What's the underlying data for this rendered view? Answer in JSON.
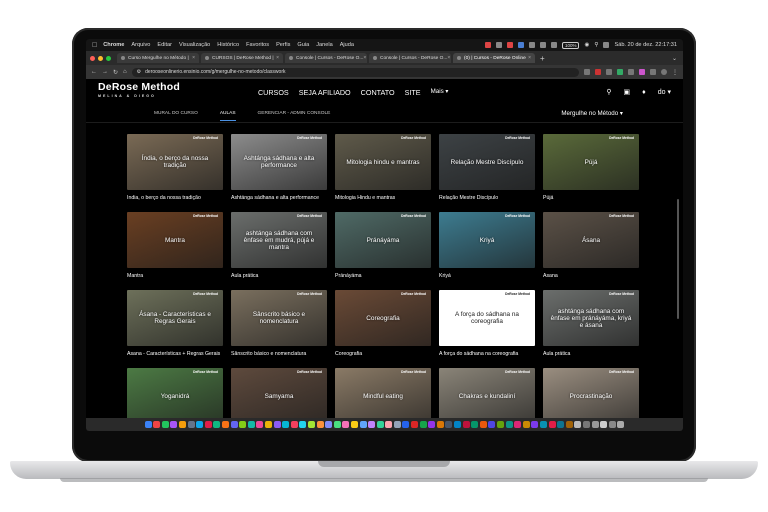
{
  "menubar": {
    "items": [
      "Chrome",
      "Arquivo",
      "Editar",
      "Visualização",
      "Histórico",
      "Favoritos",
      "Perfis",
      "Guia",
      "Janela",
      "Ajuda"
    ],
    "battery": "100%",
    "datetime": "Sáb. 20 de dez.  22:17:31"
  },
  "tabs": [
    {
      "label": "Curso Mergulhe no Método |"
    },
    {
      "label": "CURSOS | DeRose Method |"
    },
    {
      "label": "Console | Cursos - DeRose O..."
    },
    {
      "label": "Console | Cursos - DeRose O..."
    },
    {
      "label": "(0) | Cursos - DeRose Online"
    }
  ],
  "address": {
    "url": "derooseonlinerio.ensinio.com/g/mergulhe-no-metodo/classwork"
  },
  "site": {
    "logo": "DeRose Method",
    "logo_sub": "MELINA & DIEGO",
    "nav": [
      "CURSOS",
      "SEJA AFILIADO",
      "CONTATO",
      "SITE"
    ],
    "nav_more": "Mais ▾",
    "avatar": "do ▾",
    "subnav": [
      "MURAL DO CURSO",
      "AULAS",
      "GERENCIAR - ADMIN CONSOLE"
    ],
    "course_select": "Mergulhe no Método  ▾"
  },
  "badge_text": "DeRose Method",
  "lessons": [
    {
      "thumb": "Índia, o berço da nossa tradição",
      "caption": "Índia, o berço da nossa tradição",
      "color": "#7a6a55"
    },
    {
      "thumb": "Ashtánga sádhana e alta performance",
      "caption": "Ashtánga sádhana e alta performance",
      "color": "#8c8c8c"
    },
    {
      "thumb": "Mitologia hindu e mantras",
      "caption": "Mitologia Hindu e mantras",
      "color": "#5f5a4a"
    },
    {
      "thumb": "Relação Mestre Discípulo",
      "caption": "Relação Mestre Discípulo",
      "color": "#3d4245"
    },
    {
      "thumb": "Pújá",
      "caption": "Pújá",
      "color": "#5a6a3a"
    },
    {
      "thumb": "Mantra",
      "caption": "Mantra",
      "color": "#6a3f22"
    },
    {
      "thumb": "ashtánga sádhana com ênfase em mudrá, pújá e mantra",
      "caption": "Aula prática",
      "color": "#6b6e6c"
    },
    {
      "thumb": "Pránáyáma",
      "caption": "Pránáyáma",
      "color": "#4f6a66"
    },
    {
      "thumb": "Kriyá",
      "caption": "Kriyá",
      "color": "#3d7c90"
    },
    {
      "thumb": "Ásana",
      "caption": "Ásana",
      "color": "#5b5147"
    },
    {
      "thumb": "Ásana - Características e Regras Gerais",
      "caption": "Ásana - Características + Regras Gerais",
      "color": "#6d705a"
    },
    {
      "thumb": "Sânscrito básico e nomenclatura",
      "caption": "Sânscrito básico e nomenclatura",
      "color": "#7a6f5e"
    },
    {
      "thumb": "Coreografia",
      "caption": "Coreografia",
      "color": "#6a4a36"
    },
    {
      "thumb": "A força do sádhana na coreografia",
      "caption": "A força do sádhana na coreografia",
      "color": "#ffffff"
    },
    {
      "thumb": "ashtánga sádhana com ênfase em pránáyáma, kriyá e ásana",
      "caption": "Aula prática",
      "color": "#6b6e6c"
    },
    {
      "thumb": "Yoganidrá",
      "caption": "",
      "color": "#4c7a44"
    },
    {
      "thumb": "Samyama",
      "caption": "",
      "color": "#5e4a3d"
    },
    {
      "thumb": "Mindful eating",
      "caption": "",
      "color": "#8a7a66"
    },
    {
      "thumb": "Chakras e kundaliní",
      "caption": "",
      "color": "#8a8478"
    },
    {
      "thumb": "Procrastinação",
      "caption": "",
      "color": "#9a8e80"
    }
  ]
}
